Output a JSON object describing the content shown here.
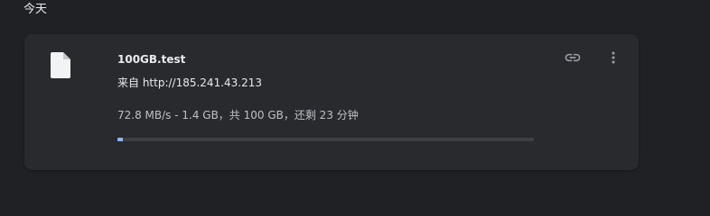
{
  "section": {
    "title": "今天"
  },
  "download": {
    "file_name": "100GB.test",
    "source": "来自 http://185.241.43.213",
    "status": "72.8 MB/s - 1.4 GB，共 100 GB，还剩 23 分钟",
    "progress_fraction": 0.014,
    "file_icon": "file-icon",
    "copy_link_icon": "link-icon",
    "more_icon": "more-vert-icon"
  },
  "colors": {
    "background": "#202124",
    "card": "#292a2d",
    "progress_track": "#3c4043",
    "progress_fill": "#8ab4f8",
    "icon": "#9aa0a6"
  }
}
